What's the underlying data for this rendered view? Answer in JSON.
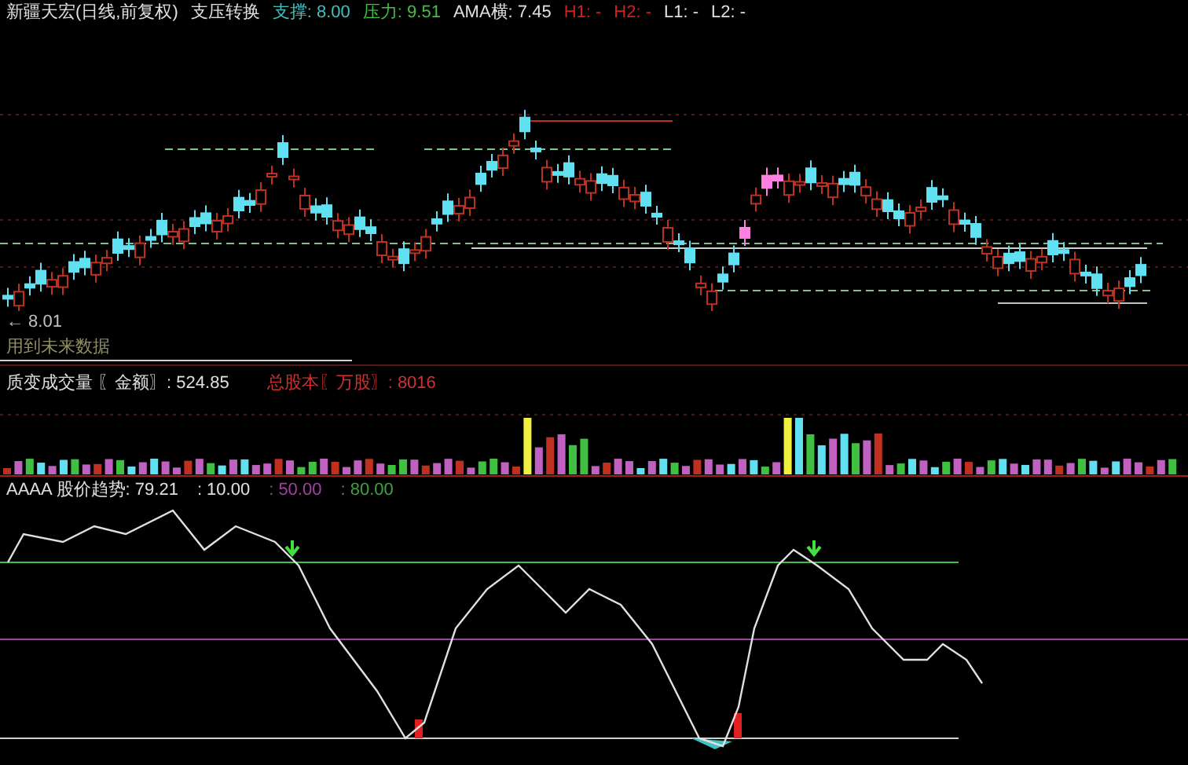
{
  "header": {
    "title": "新疆天宏(日线,前复权)",
    "indicator": "支压转换",
    "values": [
      {
        "label": "支撑: 8.00",
        "color": "#40c0c0"
      },
      {
        "label": "压力: 9.51",
        "color": "#40c040"
      },
      {
        "label": "AMA横: 7.45",
        "color": "#e0e0e0"
      },
      {
        "label": "H1: -",
        "color": "#d02020"
      },
      {
        "label": "H2: -",
        "color": "#d02020"
      },
      {
        "label": "L1: -",
        "color": "#e0e0e0"
      },
      {
        "label": "L2: -",
        "color": "#e0e0e0"
      }
    ]
  },
  "price_pane": {
    "low_label": "← 8.01",
    "warning": "用到未来数据"
  },
  "volume_pane": {
    "label": "质变成交量 〖金额〗: 524.85",
    "share_label": "总股本〖万股〗: 8016"
  },
  "indicator_pane": {
    "label": "AAAA 股价趋势: 79.21",
    "levels": [
      {
        "label": ": 10.00",
        "color": "#e0e0e0"
      },
      {
        "label": ": 50.00",
        "color": "#a040a0"
      },
      {
        "label": ": 80.00",
        "color": "#40a040"
      }
    ]
  }
}
